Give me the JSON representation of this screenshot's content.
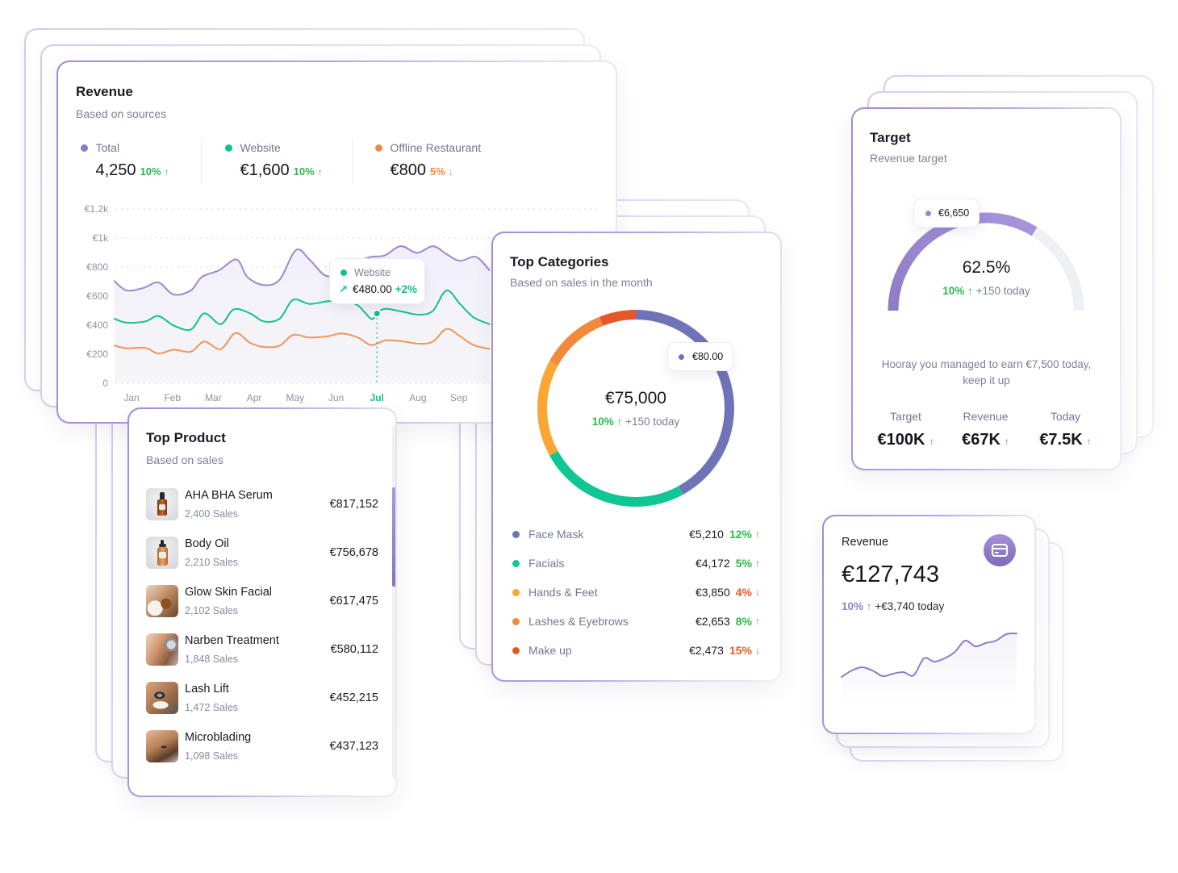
{
  "revenue_card": {
    "title": "Revenue",
    "subtitle": "Based on sources",
    "stats": [
      {
        "label": "Total",
        "value": "4,250",
        "change": "10%",
        "arrow": "↑",
        "trend": "up",
        "color": "#8e7cc3"
      },
      {
        "label": "Website",
        "value": "€1,600",
        "change": "10%",
        "arrow": "↑",
        "trend": "up",
        "color": "#12c28f"
      },
      {
        "label": "Offline Restaurant",
        "value": "€800",
        "change": "5%",
        "arrow": "↓",
        "trend": "down",
        "color": "#f28c45"
      }
    ],
    "tooltip": {
      "series": "Website",
      "series_color": "#12c28f",
      "arrow": "↗",
      "value": "€480.00",
      "change": "+2%"
    }
  },
  "top_product": {
    "title": "Top Product",
    "subtitle": "Based on sales",
    "items": [
      {
        "name": "AHA BHA Serum",
        "sales": "2,400 Sales",
        "revenue": "€817,152",
        "thumbnail": "serum-bottle"
      },
      {
        "name": "Body Oil",
        "sales": "2,210 Sales",
        "revenue": "€756,678",
        "thumbnail": "oil-bottle"
      },
      {
        "name": "Glow Skin Facial",
        "sales": "2,102 Sales",
        "revenue": "€617,475",
        "thumbnail": "facial-treatment"
      },
      {
        "name": "Narben Treatment",
        "sales": "1,848 Sales",
        "revenue": "€580,112",
        "thumbnail": "scar-treatment"
      },
      {
        "name": "Lash Lift",
        "sales": "1,472 Sales",
        "revenue": "€452,215",
        "thumbnail": "lash-lift"
      },
      {
        "name": "Microblading",
        "sales": "1,098 Sales",
        "revenue": "€437,123",
        "thumbnail": "microblading"
      }
    ]
  },
  "top_categories": {
    "title": "Top Categories",
    "subtitle": "Based on sales in the month",
    "total": "€75,000",
    "change": "10%",
    "arrow": "↑",
    "today": "+150 today",
    "tooltip": {
      "value": "€80.00",
      "color": "#6f74b9"
    },
    "items": [
      {
        "name": "Face Mask",
        "value": "€5,210",
        "change": "12%",
        "arrow": "↑",
        "trend": "up",
        "color": "#6f74b9"
      },
      {
        "name": "Facials",
        "value": "€4,172",
        "change": "5%",
        "arrow": "↑",
        "trend": "up",
        "color": "#10c695"
      },
      {
        "name": "Hands & Feet",
        "value": "€3,850",
        "change": "4%",
        "arrow": "↓",
        "trend": "down",
        "color": "#f9a633"
      },
      {
        "name": "Lashes & Eyebrows",
        "value": "€2,653",
        "change": "8%",
        "arrow": "↑",
        "trend": "up",
        "color": "#f18a3d"
      },
      {
        "name": "Make up",
        "value": "€2,473",
        "change": "15%",
        "arrow": "↓",
        "trend": "down",
        "color": "#e2582b"
      }
    ]
  },
  "target": {
    "title": "Target",
    "subtitle": "Revenue target",
    "tooltip": {
      "value": "€6,650",
      "color": "#9a86d1"
    },
    "percent": "62.5%",
    "change": "10%",
    "arrow": "↑",
    "today": "+150 today",
    "message": "Hooray you managed to earn €7,500 today, keep it up",
    "stats": [
      {
        "label": "Target",
        "value": "€100K",
        "arrow": "↑"
      },
      {
        "label": "Revenue",
        "value": "€67K",
        "arrow": "↑"
      },
      {
        "label": "Today",
        "value": "€7.5K",
        "arrow": "↑"
      }
    ]
  },
  "revenue_mini": {
    "title": "Revenue",
    "value": "€127,743",
    "change": "10%",
    "arrow": "↑",
    "today": "+€3,740 today",
    "icon": "credit-card-icon"
  },
  "colors": {
    "accent_purple": "#9a86d1",
    "positive": "#2db84b",
    "negative_orange": "#f08a3c",
    "negative_red": "#ea5a2a",
    "website_green": "#12c28f"
  },
  "chart_data": [
    {
      "type": "line",
      "title": "Revenue",
      "subtitle": "Based on sources",
      "xlabel": "",
      "ylabel": "",
      "x_unit": "month index (Jan = 1)",
      "x_tick_labels": [
        "Jan",
        "Feb",
        "Mar",
        "Apr",
        "May",
        "Jun",
        "Jul",
        "Aug",
        "Sep"
      ],
      "highlight_x_label": "Jul",
      "y_ticks": [
        0,
        200,
        400,
        600,
        800,
        1000,
        1200
      ],
      "y_tick_labels": [
        "0",
        "€200",
        "€400",
        "€600",
        "€800",
        "€1k",
        "€1.2k"
      ],
      "ylim": [
        0,
        1200
      ],
      "grid": true,
      "series": [
        {
          "name": "Total",
          "color": "#9d89d0",
          "points": [
            [
              0.58,
              704
            ],
            [
              0.88,
              639
            ],
            [
              1.3,
              657
            ],
            [
              1.66,
              694
            ],
            [
              2.03,
              611
            ],
            [
              2.45,
              639
            ],
            [
              2.72,
              732
            ],
            [
              3.14,
              778
            ],
            [
              3.57,
              852
            ],
            [
              3.83,
              732
            ],
            [
              4.23,
              676
            ],
            [
              4.62,
              713
            ],
            [
              5.02,
              917
            ],
            [
              5.35,
              852
            ],
            [
              5.74,
              741
            ],
            [
              6.1,
              760
            ],
            [
              6.5,
              835
            ],
            [
              6.86,
              870
            ],
            [
              7.19,
              880
            ],
            [
              7.58,
              944
            ],
            [
              7.98,
              898
            ],
            [
              8.37,
              944
            ],
            [
              8.7,
              889
            ],
            [
              9.03,
              843
            ],
            [
              9.42,
              870
            ],
            [
              9.75,
              778
            ]
          ]
        },
        {
          "name": "Website",
          "color": "#12c28f",
          "points": [
            [
              0.58,
              444
            ],
            [
              0.88,
              417
            ],
            [
              1.34,
              426
            ],
            [
              1.66,
              463
            ],
            [
              2.03,
              398
            ],
            [
              2.45,
              370
            ],
            [
              2.78,
              481
            ],
            [
              3.18,
              407
            ],
            [
              3.5,
              509
            ],
            [
              3.9,
              481
            ],
            [
              4.23,
              426
            ],
            [
              4.62,
              444
            ],
            [
              4.95,
              574
            ],
            [
              5.35,
              546
            ],
            [
              5.81,
              565
            ],
            [
              6.2,
              562
            ],
            [
              6.53,
              537
            ],
            [
              6.86,
              444
            ],
            [
              7.01,
              485
            ],
            [
              7.22,
              513
            ],
            [
              7.65,
              491
            ],
            [
              8.04,
              472
            ],
            [
              8.37,
              500
            ],
            [
              8.7,
              639
            ],
            [
              9.03,
              546
            ],
            [
              9.36,
              454
            ],
            [
              9.75,
              407
            ]
          ]
        },
        {
          "name": "Offline Restaurant",
          "color": "#f2945a",
          "points": [
            [
              0.58,
              259
            ],
            [
              0.88,
              241
            ],
            [
              1.34,
              244
            ],
            [
              1.66,
              204
            ],
            [
              2.03,
              231
            ],
            [
              2.45,
              217
            ],
            [
              2.78,
              287
            ],
            [
              3.18,
              235
            ],
            [
              3.54,
              346
            ],
            [
              3.9,
              278
            ],
            [
              4.23,
              250
            ],
            [
              4.62,
              259
            ],
            [
              4.95,
              333
            ],
            [
              5.35,
              315
            ],
            [
              5.81,
              324
            ],
            [
              6.13,
              343
            ],
            [
              6.53,
              315
            ],
            [
              6.86,
              263
            ],
            [
              7.22,
              296
            ],
            [
              7.65,
              287
            ],
            [
              8.04,
              272
            ],
            [
              8.37,
              287
            ],
            [
              8.7,
              374
            ],
            [
              9.03,
              324
            ],
            [
              9.36,
              263
            ],
            [
              9.75,
              237
            ]
          ]
        }
      ],
      "highlight_point": {
        "series": "Website",
        "x": 7.0,
        "y": 480,
        "label": "€480.00",
        "change": "+2%"
      }
    },
    {
      "type": "pie",
      "variant": "donut",
      "title": "Top Categories",
      "categories": [
        "Face Mask",
        "Facials",
        "Hands & Feet",
        "Lashes & Eyebrows",
        "Make up"
      ],
      "values": [
        5210,
        4172,
        3850,
        2653,
        2473
      ],
      "segment_share_pct": [
        42,
        25,
        16,
        11,
        6
      ],
      "colors": [
        "#6f74b9",
        "#10c695",
        "#f9a633",
        "#f18a3d",
        "#e2582b"
      ],
      "center_label": "€75,000",
      "track_color": "#f0f0f5"
    },
    {
      "type": "pie",
      "variant": "semicircle-gauge",
      "title": "Target",
      "label": "62.5%",
      "fill_fraction": 0.675,
      "fill_color": "#9a86d1",
      "track_color": "#eff0f5"
    },
    {
      "type": "area",
      "variant": "sparkline",
      "title": "Revenue",
      "values": [
        21,
        29,
        33,
        29,
        22,
        25,
        27,
        23,
        44,
        40,
        44,
        52,
        66,
        59,
        63,
        66,
        74,
        75
      ],
      "color": "#8f7bc9"
    }
  ]
}
